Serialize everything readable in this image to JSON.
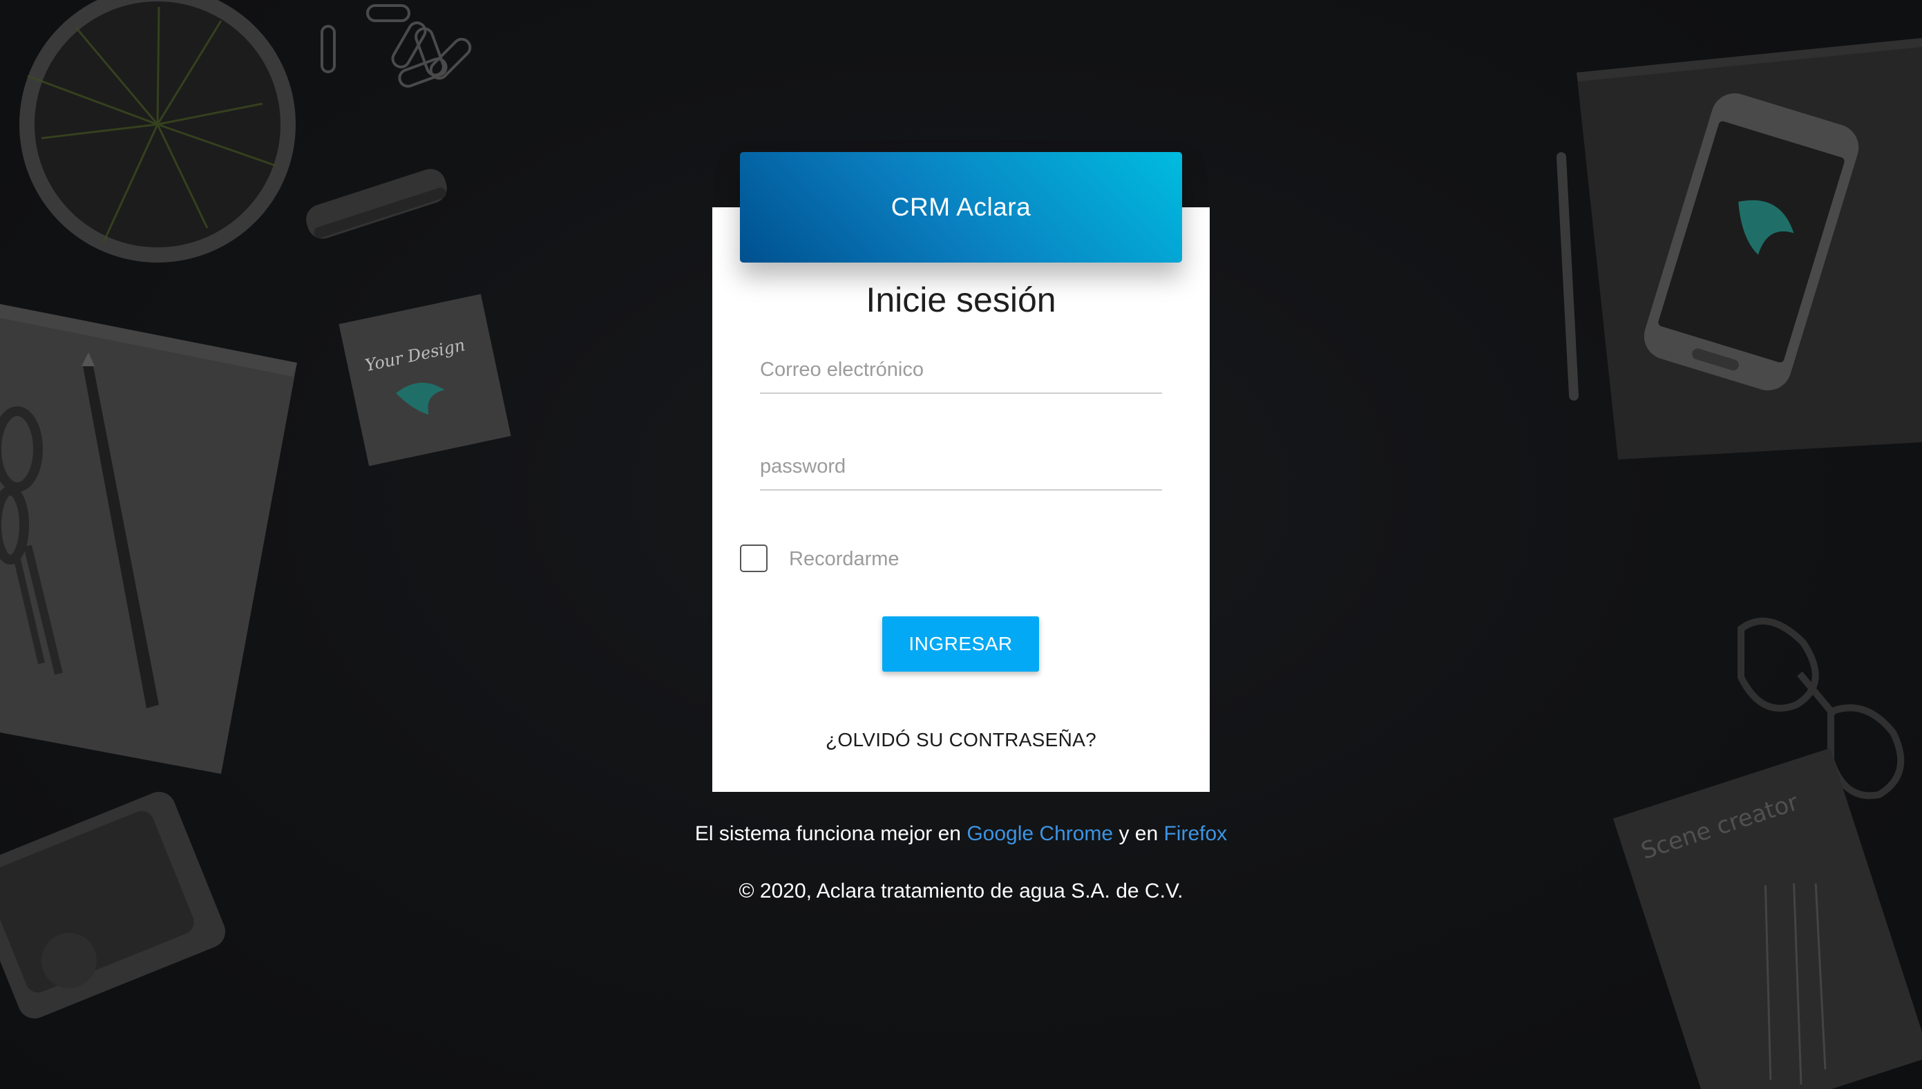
{
  "header": {
    "title": "CRM Aclara"
  },
  "login": {
    "heading": "Inicie sesión",
    "email_placeholder": "Correo electrónico",
    "email_value": "",
    "password_placeholder": "password",
    "password_value": "",
    "remember_label": "Recordarme",
    "remember_checked": false,
    "submit_label": "INGRESAR",
    "forgot_label": "¿OLVIDÓ SU CONTRASEÑA?"
  },
  "footer": {
    "browser_prefix": "El sistema funciona mejor en ",
    "chrome_label": "Google Chrome",
    "browser_middle": " y en ",
    "firefox_label": "Firefox",
    "copyright": "© 2020, Aclara tratamiento de agua S.A. de C.V."
  },
  "background": {
    "sticky_note_text": "Your Design",
    "book_title": "Scene creator"
  },
  "colors": {
    "page_background": "#111214",
    "header_gradient_start": "#00508f",
    "header_gradient_end": "#00bce0",
    "button": "#03a9f4",
    "link": "#3d94e3",
    "brand_bird": "#1f6f68"
  },
  "icons": {
    "background_logo": "bird-logo-icon",
    "remember_checkbox": "checkbox-icon"
  }
}
